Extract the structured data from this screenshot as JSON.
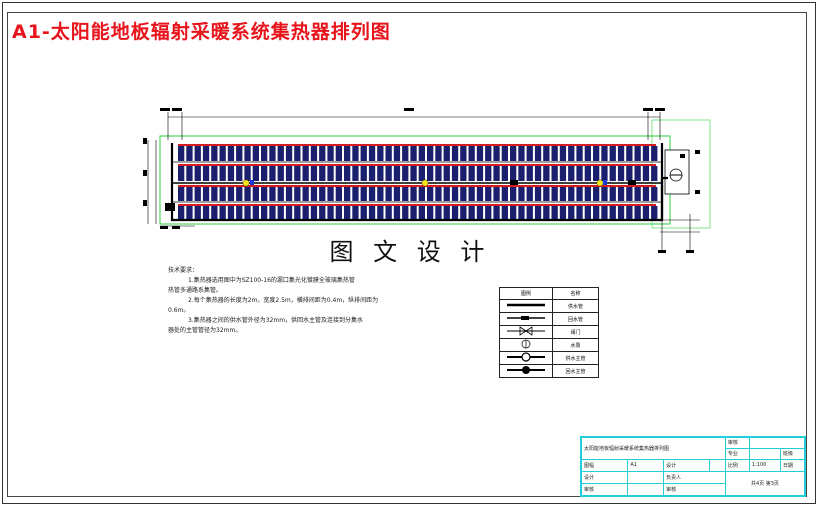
{
  "title": "A1-太阳能地板辐射采暖系统集热器排列图",
  "banner": "图 文 设 计",
  "notes": {
    "heading": "技术要求：",
    "lines": [
      "1.集热器选用图中为SZ100-16的漏口集光化镀膜全玻璃集热管",
      "热管多通路系集管。",
      "2.每个集热器的长度为2m，宽度2.5m，横排间距为0.4m，纵排间距为",
      "0.6m。",
      "3.集热器之间的供水管外径为32mm，供回水主管及连接到分集水",
      "器处的主管管径为32mm。"
    ]
  },
  "legend": {
    "header": [
      "图例",
      "名称"
    ],
    "rows": [
      {
        "icon": "supply-pipe-icon",
        "label": "供水管"
      },
      {
        "icon": "return-pipe-icon",
        "label": "回水管"
      },
      {
        "icon": "valve-icon",
        "label": "阀门"
      },
      {
        "icon": "pump-icon",
        "label": "水泵"
      },
      {
        "icon": "supply-main-icon",
        "label": "供水主管"
      },
      {
        "icon": "return-main-icon",
        "label": "回水主管"
      }
    ]
  },
  "title_block": {
    "drawing_name": "太阳能地板辐射采暖系统集热器排列图",
    "review_label": "审核",
    "major_label": "专业",
    "class_label": "班级",
    "sheet_size_label": "图幅",
    "sheet_size": "A1",
    "design_label": "设计",
    "scale_label": "比例",
    "scale": "1:100",
    "date_label": "日期",
    "designer_label": "设计",
    "designer": "负责人",
    "check_label": "审核",
    "checker": "审核",
    "pages": "共4页 第3页"
  },
  "colors": {
    "title_red": "#e8141b",
    "collector_navy": "#1a1f6e",
    "collector_red": "#d61c1c",
    "outline_green": "#2ecc40",
    "title_block_cyan": "#1fd0d8"
  }
}
